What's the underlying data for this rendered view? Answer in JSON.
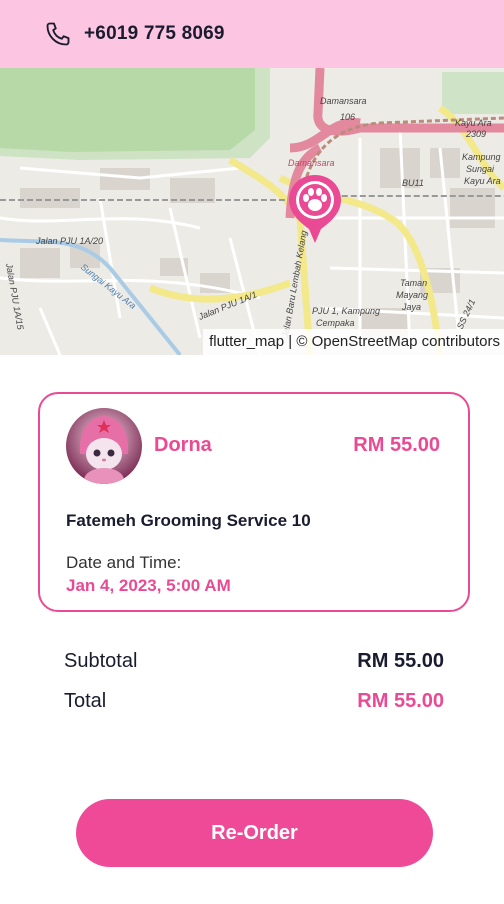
{
  "header": {
    "phone_icon": "phone-icon",
    "phone": "+6019 775 8069"
  },
  "map": {
    "attribution": "flutter_map | © OpenStreetMap contributors",
    "pin_icon": "paw-icon",
    "labels": {
      "damansara_top": "Damansara",
      "road_106": "106",
      "kayu_ara_top": "Kayu Ara",
      "road_2309": "2309",
      "damansara_mid": "Damansara",
      "bu11": "BU11",
      "kampung": "Kampung",
      "sungai": "Sungai",
      "kayu_ara": "Kayu Ara",
      "jalan_pju_1a20": "Jalan PJU 1A/20",
      "jalan_pju_1a15": "Jalan PJU 1A/15",
      "sungai_kayu_ara": "Sungai Kayu Ara",
      "jalan_pju_1a1": "Jalan PJU 1A/1",
      "jalan_baru": "Jalan Baru Lembah Kelang",
      "taman": "Taman",
      "mayang": "Mayang",
      "jaya": "Jaya",
      "pju1": "PJU 1, Kampung",
      "cempaka": "Cempaka",
      "ss24": "SS 24/1"
    }
  },
  "order": {
    "name": "Dorna",
    "price": "RM 55.00",
    "service": "Fatemeh Grooming Service 10",
    "datetime_label": "Date and Time:",
    "datetime_value": "Jan 4, 2023, 5:00 AM"
  },
  "summary": {
    "subtotal_label": "Subtotal",
    "subtotal_value": "RM 55.00",
    "total_label": "Total",
    "total_value": "RM 55.00"
  },
  "actions": {
    "reorder_label": "Re-Order"
  },
  "colors": {
    "accent": "#ea4a93",
    "header_bg": "#fcc6e3",
    "button_bg": "#ef4a97",
    "dark_text": "#1a1b2e"
  }
}
